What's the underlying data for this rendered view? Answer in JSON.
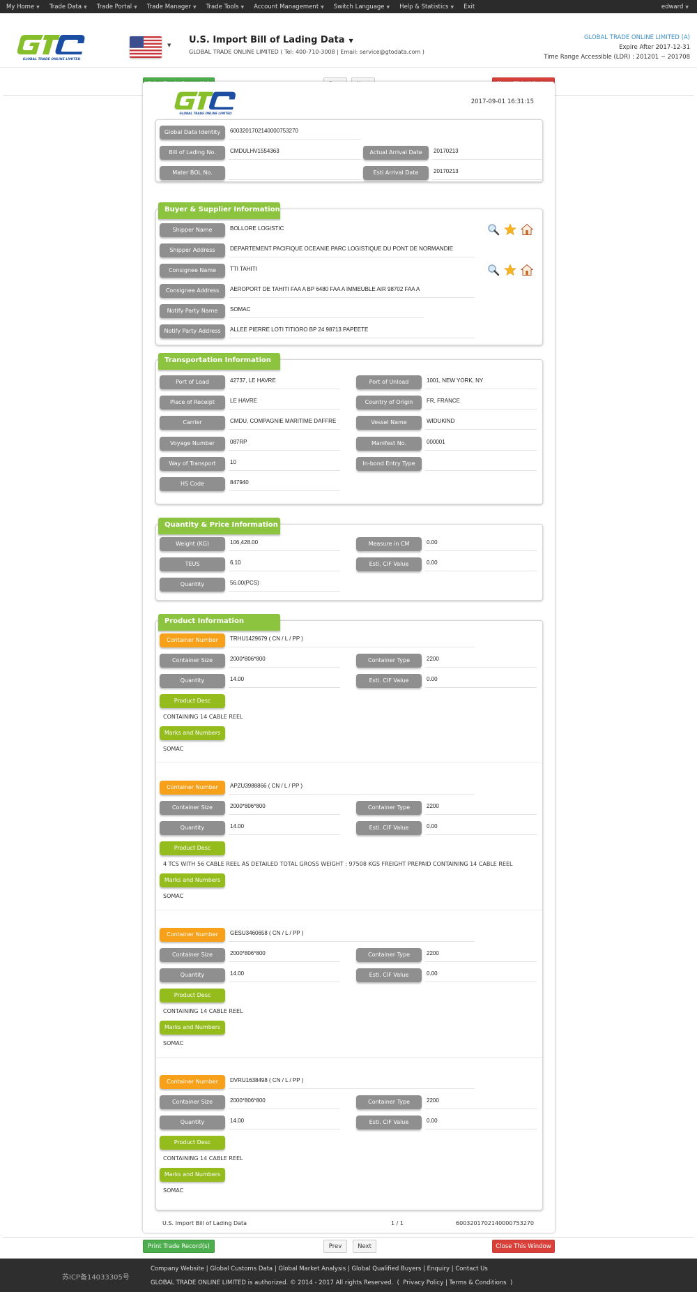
{
  "nav": {
    "items": [
      "My Home",
      "Trade Data",
      "Trade Portal",
      "Trade Manager",
      "Trade Tools",
      "Account Management",
      "Switch Language",
      "Help & Statistics",
      "Exit"
    ],
    "user": "edward"
  },
  "header": {
    "logo_text": "GLOBAL TRADE ONLINE LIMITED",
    "title": "U.S. Import Bill of Lading Data",
    "subtitle": "GLOBAL TRADE ONLINE LIMITED ( Tel: 400-710-3008 | Email: service@gtodata.com )",
    "account_company": "GLOBAL TRADE ONLINE LIMITED (A)",
    "expire": "Expire After 2017-12-31",
    "time_range": "Time Range Accessible (LDR) : 201201 ~ 201708"
  },
  "toolbar": {
    "print_label": "Print Trade Record(s)",
    "prev_label": "Prev",
    "next_label": "Next",
    "close_label": "Close This Window"
  },
  "record": {
    "timestamp": "2017-09-01 16:31:15",
    "ids": {
      "global_data_identity_label": "Global Data Identity",
      "global_data_identity": "6003201702140000753270",
      "bol_label": "Bill of Lading No.",
      "bol": "CMDULHV1554363",
      "actual_arrival_label": "Actual Arrival Date",
      "actual_arrival": "20170213",
      "mater_bol_label": "Mater BOL No.",
      "mater_bol": "",
      "esti_arrival_label": "Esti Arrival Date",
      "esti_arrival": "20170213"
    },
    "buyer_supplier": {
      "title": "Buyer & Supplier Information",
      "shipper_name_label": "Shipper Name",
      "shipper_name": "BOLLORE LOGISTIC",
      "shipper_address_label": "Shipper Address",
      "shipper_address": "DEPARTEMENT PACIFIQUE OCEANIE PARC LOGISTIQUE DU PONT DE NORMANDIE",
      "consignee_name_label": "Consignee Name",
      "consignee_name": "TTI TAHITI",
      "consignee_address_label": "Consignee Address",
      "consignee_address": "AEROPORT DE TAHITI FAA A BP 6480 FAA A IMMEUBLE AIR 98702 FAA A",
      "notify_name_label": "Notify Party Name",
      "notify_name": "SOMAC",
      "notify_address_label": "Notify Party Address",
      "notify_address": "ALLEE PIERRE LOTI TITIORO BP 24 98713 PAPEETE"
    },
    "transportation": {
      "title": "Transportation Information",
      "port_of_load_label": "Port of Load",
      "port_of_load": "42737, LE HAVRE",
      "port_of_unload_label": "Port of Unload",
      "port_of_unload": "1001, NEW YORK, NY",
      "place_of_receipt_label": "Place of Receipt",
      "place_of_receipt": "LE HAVRE",
      "country_of_origin_label": "Country of Origin",
      "country_of_origin": "FR, FRANCE",
      "carrier_label": "Carrier",
      "carrier": "CMDU, COMPAGNIE MARITIME DAFFRE",
      "vessel_name_label": "Vessel Name",
      "vessel_name": "WIDUKIND",
      "voyage_number_label": "Voyage Number",
      "voyage_number": "087RP",
      "manifest_no_label": "Manifest No.",
      "manifest_no": "000001",
      "way_of_transport_label": "Way of Transport",
      "way_of_transport": "10",
      "inbond_entry_type_label": "In-bond Entry Type",
      "inbond_entry_type": "",
      "hs_code_label": "HS Code",
      "hs_code": "847940"
    },
    "quantity_price": {
      "title": "Quantity & Price Information",
      "weight_label": "Weight (KG)",
      "weight": "106,428.00",
      "measure_label": "Measure in CM",
      "measure": "0.00",
      "teus_label": "TEUS",
      "teus": "6.10",
      "cif_label": "Esti. CIF Value",
      "cif": "0.00",
      "quantity_label": "Quantity",
      "quantity": "56.00(PCS)"
    },
    "product": {
      "title": "Product Information",
      "labels": {
        "container_number": "Container Number",
        "container_size": "Container Size",
        "container_type": "Container Type",
        "quantity": "Quantity",
        "cif": "Esti. CIF Value",
        "product_desc": "Product Desc",
        "marks": "Marks and Numbers"
      },
      "containers": [
        {
          "number": "TRHU1429679 ( CN / L / PP )",
          "size": "2000*806*800",
          "type": "2200",
          "quantity": "14.00",
          "cif": "0.00",
          "desc": "CONTAINING 14 CABLE REEL",
          "marks": "SOMAC"
        },
        {
          "number": "APZU3988866 ( CN / L / PP )",
          "size": "2000*806*800",
          "type": "2200",
          "quantity": "14.00",
          "cif": "0.00",
          "desc": "4 TCS WITH 56 CABLE REEL AS DETAILED TOTAL GROSS WEIGHT : 97508 KGS FREIGHT PREPAID CONTAINING 14 CABLE REEL",
          "marks": "SOMAC"
        },
        {
          "number": "GESU3460658 ( CN / L / PP )",
          "size": "2000*806*800",
          "type": "2200",
          "quantity": "14.00",
          "cif": "0.00",
          "desc": "CONTAINING 14 CABLE REEL",
          "marks": "SOMAC"
        },
        {
          "number": "DVRU1638498 ( CN / L / PP )",
          "size": "2000*806*800",
          "type": "2200",
          "quantity": "14.00",
          "cif": "0.00",
          "desc": "CONTAINING 14 CABLE REEL",
          "marks": "SOMAC"
        }
      ]
    },
    "footer": {
      "source": "U.S. Import Bill of Lading Data",
      "page": "1 / 1",
      "id": "6003201702140000753270"
    }
  },
  "footer": {
    "icp": "苏ICP备14033305号",
    "links": [
      "Company Website",
      "Global Customs Data",
      "Global Market Analysis",
      "Global Qualified Buyers",
      "Enquiry",
      "Contact Us"
    ],
    "copyright": "GLOBAL TRADE ONLINE LIMITED is authorized. © 2014 - 2017 All rights Reserved.",
    "policy_links": [
      "Privacy Policy",
      "Terms & Conditions"
    ]
  },
  "colors": {
    "nav_bg": "#2b2b2b",
    "section_green": "#8cc43f",
    "label_gray": "#8f8f8f",
    "label_orange": "#f7a11a",
    "label_olive": "#94bc1c",
    "print_green": "#4cae4c",
    "close_red": "#d9403a",
    "account_blue": "#3a8ec8"
  }
}
